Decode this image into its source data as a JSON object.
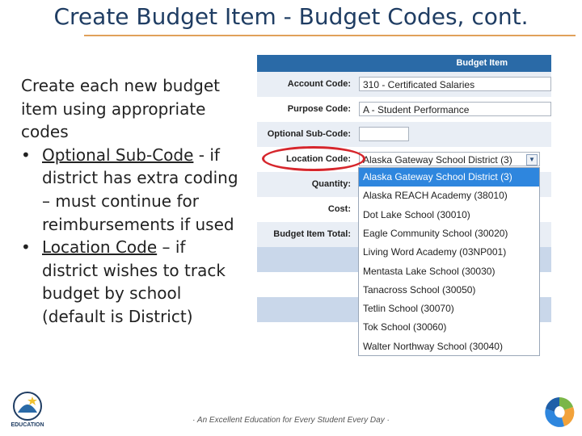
{
  "slide": {
    "title": "Create Budget Item - Budget Codes, cont.",
    "intro": "Create each new budget item using appropriate codes",
    "bullets": [
      {
        "underlined": "Optional Sub-Code",
        "rest": " - if district has extra coding – must continue for reimbursements if used"
      },
      {
        "underlined": "Location Code",
        "rest": " – if district wishes to track budget by school (default is District)"
      }
    ],
    "footer": "· An Excellent Education for Every Student Every Day ·",
    "left_logo_text": "EDUCATION"
  },
  "form": {
    "header": "Budget Item",
    "labels": {
      "account": "Account Code:",
      "purpose": "Purpose Code:",
      "subcode": "Optional Sub-Code:",
      "location": "Location Code:",
      "quantity": "Quantity:",
      "cost": "Cost:",
      "total": "Budget Item Total:"
    },
    "values": {
      "account": "310 - Certificated Salaries",
      "purpose": "A - Student Performance",
      "subcode": "",
      "location": "Alaska Gateway School District (3)"
    }
  },
  "dropdown": {
    "options": [
      "Alaska Gateway School District (3)",
      "Alaska REACH Academy (38010)",
      "Dot Lake School (30010)",
      "Eagle Community School (30020)",
      "Living Word Academy (03NP001)",
      "Mentasta Lake School (30030)",
      "Tanacross School (30050)",
      "Tetlin School (30070)",
      "Tok School (30060)",
      "Walter Northway School (30040)"
    ],
    "selected_index": 0
  },
  "colors": {
    "title": "#1f3d63",
    "rule": "#e0a15a",
    "header": "#2a6aa7",
    "highlight": "#2e86de",
    "circle": "#d6262c"
  }
}
